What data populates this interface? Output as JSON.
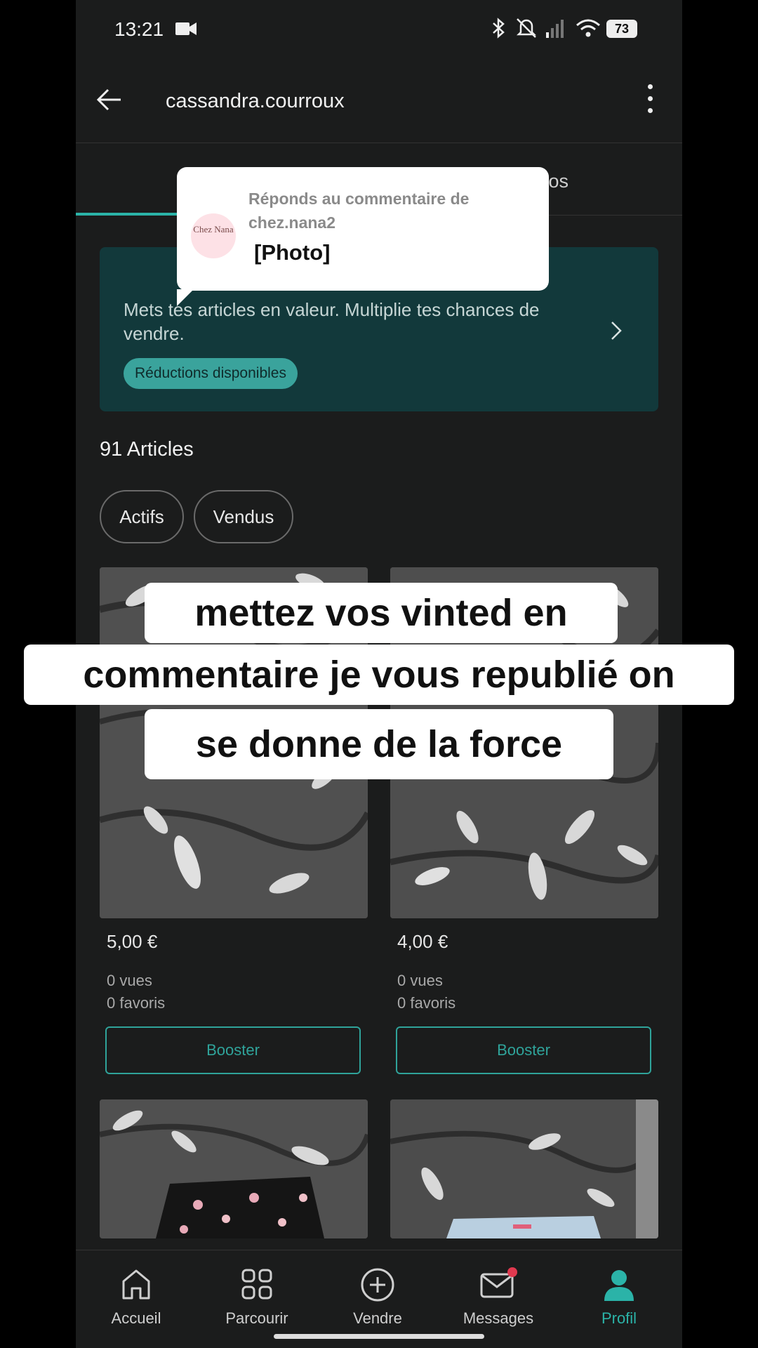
{
  "status": {
    "time": "13:21",
    "battery": "73"
  },
  "header": {
    "username": "cassandra.courroux"
  },
  "tabs": {
    "about": "À propos"
  },
  "promo": {
    "text": "Mets tes articles en valeur. Multiplie tes chances de vendre.",
    "badge": "Réductions disponibles"
  },
  "reply_tooltip": {
    "title": "Réponds au commentaire de chez.nana2",
    "content": "[Photo]",
    "avatar_text": "Chez Nana"
  },
  "articles": {
    "count_label": "91 Articles",
    "filters": [
      "Actifs",
      "Vendus"
    ],
    "items": [
      {
        "price": "5,00 €",
        "views": "0 vues",
        "favorites": "0 favoris",
        "action": "Booster"
      },
      {
        "price": "4,00 €",
        "views": "0 vues",
        "favorites": "0 favoris",
        "action": "Booster"
      }
    ]
  },
  "caption": {
    "line1": "mettez vos vinted en",
    "line2": "commentaire je vous republié on",
    "line3": "se donne de la force"
  },
  "nav": {
    "items": [
      "Accueil",
      "Parcourir",
      "Vendre",
      "Messages",
      "Profil"
    ],
    "active": "Profil"
  },
  "colors": {
    "accent": "#2bb3a8",
    "promo_bg": "#12393b",
    "background": "#1b1c1c"
  }
}
